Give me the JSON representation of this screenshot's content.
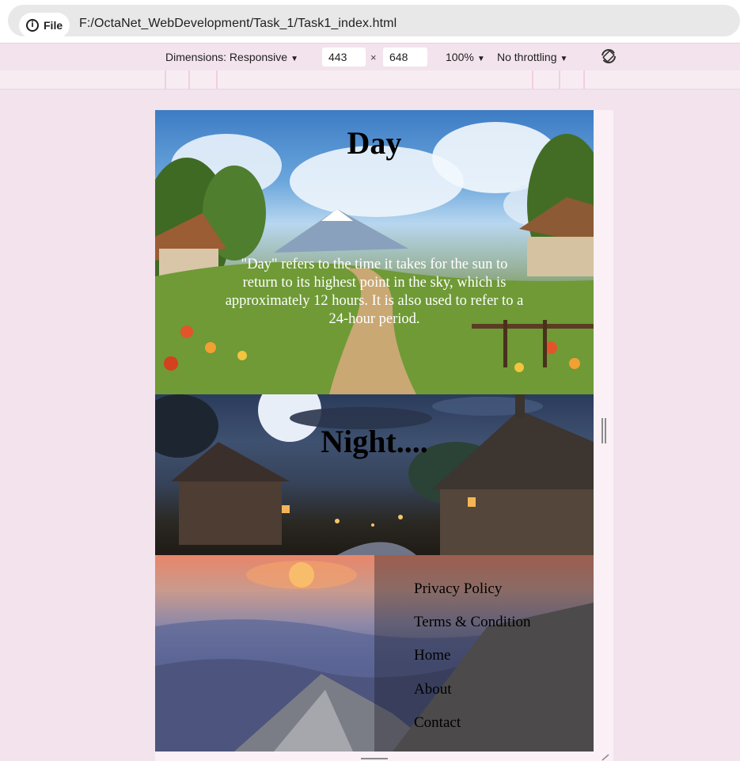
{
  "browser": {
    "file_label": "File",
    "url": "F:/OctaNet_WebDevelopment/Task_1/Task1_index.html"
  },
  "device_toolbar": {
    "dimensions_label": "Dimensions: Responsive",
    "width": "443",
    "times": "×",
    "height": "648",
    "zoom": "100%",
    "throttling": "No throttling"
  },
  "page": {
    "day": {
      "title": "Day",
      "description": "\"Day\" refers to the time it takes for the sun to return to its highest point in the sky, which is approximately 12 hours. It is also used to refer to a 24-hour period."
    },
    "night": {
      "title": "Night...."
    },
    "footer": {
      "links": [
        "Privacy Policy",
        "Terms & Condition",
        "Home",
        "About",
        "Contact"
      ]
    }
  },
  "colors": {
    "text_dark": "#000000",
    "text_light": "#ffffff",
    "devtools_bg": "#f3e3ec"
  },
  "icons": {
    "info": "info-icon",
    "caret": "caret-down-icon",
    "rotate": "rotate-icon"
  }
}
